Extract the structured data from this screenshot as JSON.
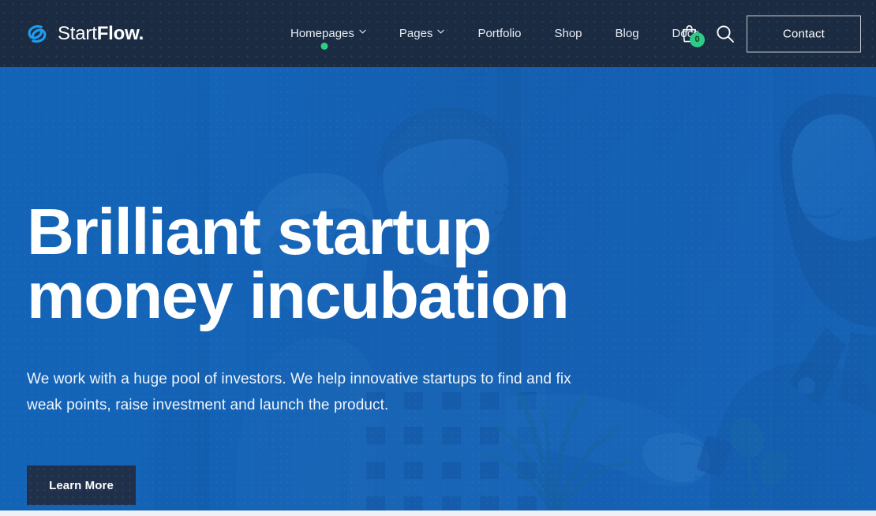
{
  "header": {
    "logo": {
      "icon": "startflow-swirl-logo-icon",
      "text_light": "Start",
      "text_bold": "Flow."
    },
    "nav": [
      {
        "label": "Homepages",
        "has_caret": true,
        "active_dot": true
      },
      {
        "label": "Pages",
        "has_caret": true,
        "active_dot": false
      },
      {
        "label": "Portfolio",
        "has_caret": false,
        "active_dot": false
      },
      {
        "label": "Shop",
        "has_caret": false,
        "active_dot": false
      },
      {
        "label": "Blog",
        "has_caret": false,
        "active_dot": false
      },
      {
        "label": "Docs",
        "has_caret": false,
        "active_dot": false
      }
    ],
    "cart": {
      "icon": "shopping-bag-icon",
      "count": "0"
    },
    "search": {
      "icon": "search-icon"
    },
    "contact_button": "Contact",
    "bg_color": "#1b2b42"
  },
  "hero": {
    "title_line1": "Brilliant startup",
    "title_line2": "money incubation",
    "subtitle_line1": "We work with a huge pool of investors. We help innovative startups to find and fix",
    "subtitle_line2": "weak points, raise investment and launch the product.",
    "cta_button": "Learn More",
    "overlay_color": "#1766b8",
    "cta_bg_color": "#21304a",
    "accent_color": "#2ecc87"
  }
}
